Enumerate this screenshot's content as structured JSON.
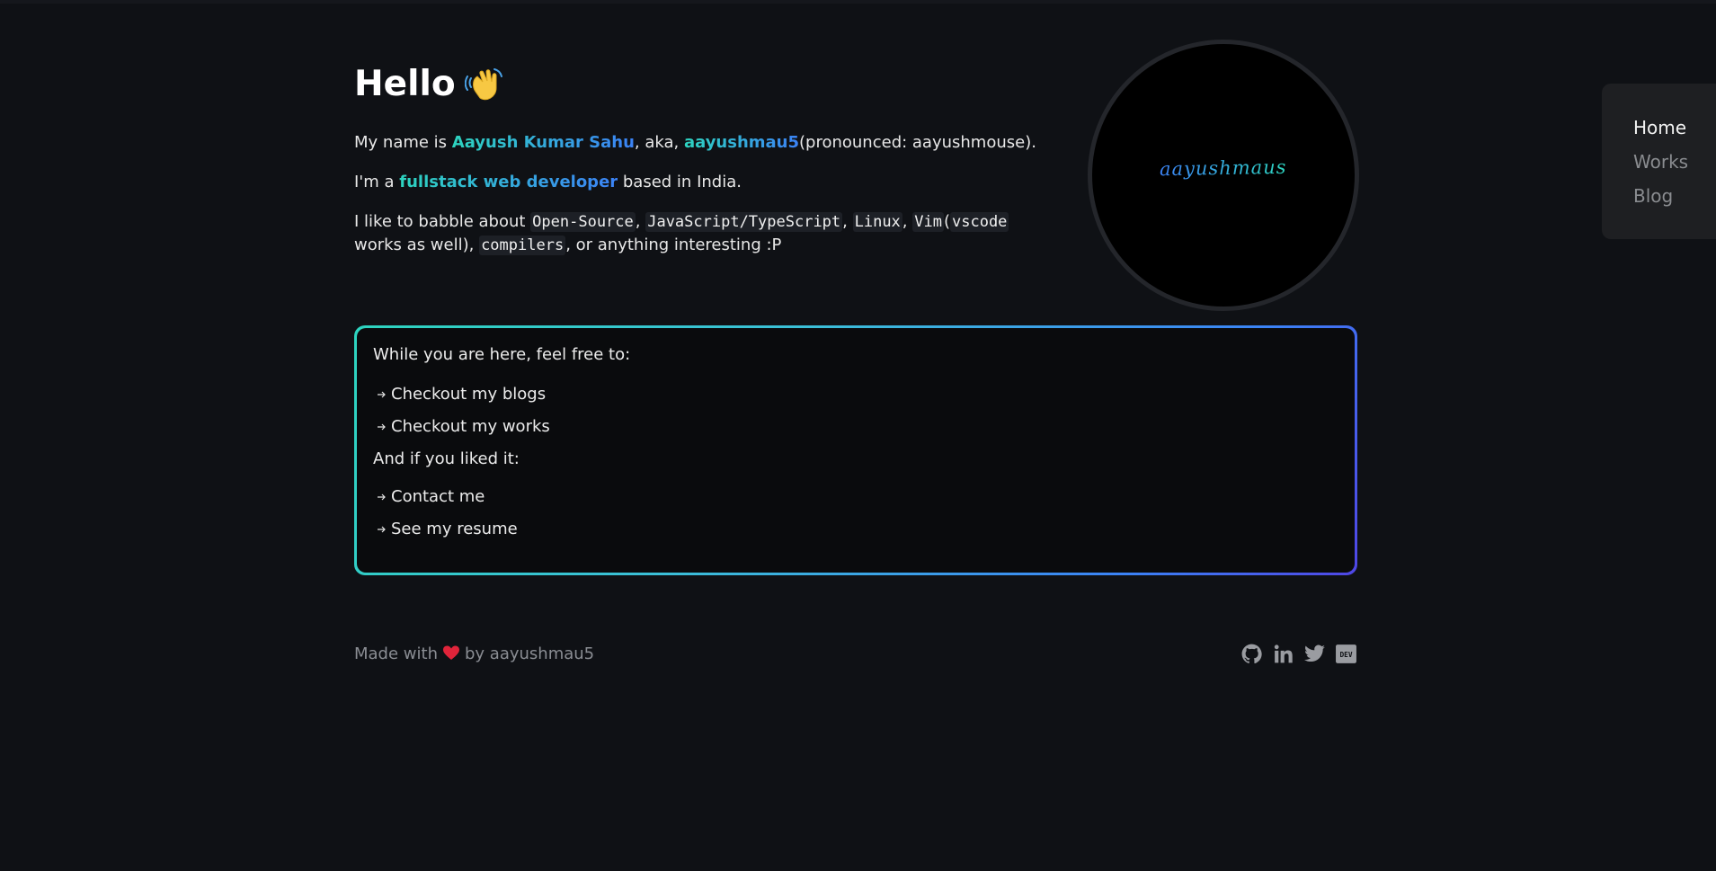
{
  "hero": {
    "greeting": "Hello",
    "intro": {
      "prefix": "My name is ",
      "full_name": "Aayush Kumar Sahu",
      "aka_text": ", aka, ",
      "handle": "aayushmau5",
      "pronounced": "(pronounced: aayushmouse)."
    },
    "role": {
      "prefix": "I'm a ",
      "title": "fullstack web developer",
      "suffix": " based in India."
    },
    "interests": {
      "prefix": "I like to babble about ",
      "items": [
        "Open-Source",
        "JavaScript/TypeScript",
        "Linux",
        "Vim",
        "vscode",
        "compilers"
      ],
      "sep1": ", ",
      "sep2": ", ",
      "sep3": ", ",
      "paren_open": "(",
      "paren_text": " works as well), ",
      "suffix": ", or anything interesting :P"
    },
    "avatar_signature": "aayushmaus"
  },
  "card": {
    "heading1": "While you are here, feel free to:",
    "links1": [
      "Checkout my blogs",
      "Checkout my works"
    ],
    "heading2": "And if you liked it:",
    "links2": [
      "Contact me",
      "See my resume"
    ]
  },
  "footer": {
    "made_with": "Made with",
    "by": "by aayushmau5",
    "socials": [
      "github-icon",
      "linkedin-icon",
      "twitter-icon",
      "dev-icon"
    ]
  },
  "nav": {
    "items": [
      "Home",
      "Works",
      "Blog"
    ],
    "active": "Home"
  },
  "colors": {
    "background": "#0f1115",
    "accent_start": "#2dd4bf",
    "accent_end": "#3b82f6",
    "nav_bg": "#1e1f22",
    "heart": "#e0243a"
  }
}
